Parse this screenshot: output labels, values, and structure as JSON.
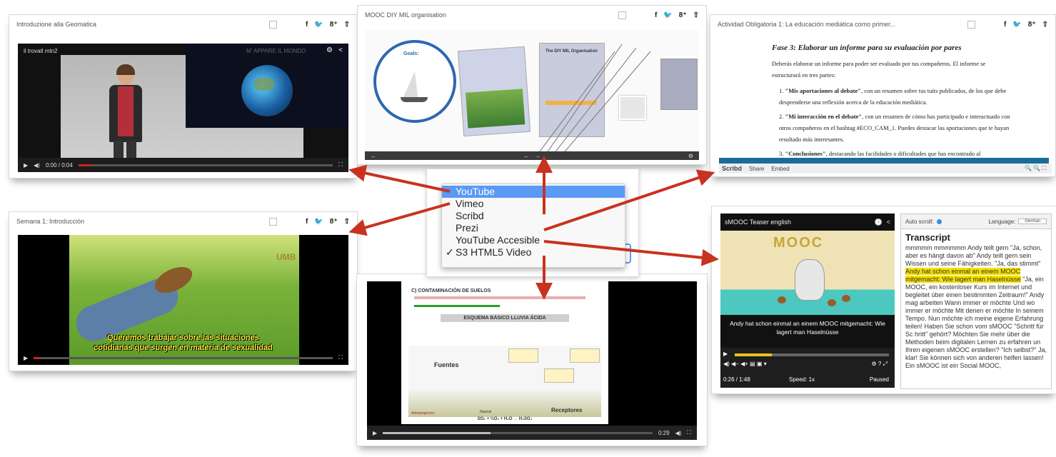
{
  "cards": {
    "geomatica": {
      "title": "Introduzione alla Geomatica",
      "video_channel": "il trovatl mtn2",
      "video_caption": "M' APPARE IL MONDO",
      "time": "0:00 / 0:04"
    },
    "prezi": {
      "title": "MOOC DIY MIL organisation",
      "bubble_title": "Goals:",
      "note_title": "The DIY MIL Organisation"
    },
    "scribd": {
      "title": "Actividad Obligatoria 1: La educación mediática como primer...",
      "heading": "Fase 3: Elaborar un informe para su evaluación por pares",
      "intro": "Deberás elaborar un informe para poder ser evaluado por tus compañeros. El informe se estructurará en tres partes:",
      "items": [
        {
          "num": "1.",
          "bold": "\"Mis aportaciones al debate\"",
          "text": ", con un resumen sobre tus tuits publicados, de los que debe desprenderse una reflexión acerca de la educación mediática."
        },
        {
          "num": "2.",
          "bold": "\"Mi interacción en el debate\"",
          "text": ", con un resumen de cómo has participado e interactuado con otros compañeros en el hashtag #ECO_CAM_1. Puedes destacar las aportaciones que te hayan resultado más interesantes."
        },
        {
          "num": "3.",
          "bold": "\"Conclusiones\"",
          "text": ", destacando las facilidades o dificultades que has encontrado al"
        }
      ],
      "footer_brand": "Scribd",
      "footer_share": "Share",
      "footer_embed": "Embed"
    },
    "semana": {
      "title": "Semana 1: Introducción",
      "logo": "UMB",
      "subtitle1": "Queremos trabajar sobre las situaciones",
      "subtitle2": "cotidianas que surgen en materia de sexualidad"
    },
    "slides": {
      "slide_title": "C) CONTAMINACIÓN DE SUELOS",
      "box_title": "ESQUEMA BÁSICO LLUVIA ÁCIDA",
      "label_fuentes": "Fuentes",
      "label_receptores": "Receptores",
      "label_natural": "Natural",
      "label_antropogenico": "Antropogénico",
      "equation": "SO₂ + ½O₂ + H₂O → H₂SO₄",
      "time": "0:29"
    },
    "smooc": {
      "title": "sMOOC Teaser english",
      "logo_text": "MOOC",
      "subtitle": "Andy hat schon einmal an einem MOOC mitgemacht: Wie lagert man Haselnüsse",
      "time": "0:26 / 1:48",
      "speed": "Speed: 1x",
      "status": "Paused",
      "auto_scroll": "Auto scroll:",
      "language_label": "Language:",
      "language_value": "German",
      "transcript_heading": "Transcript",
      "transcript_pre": "mmmmm mmmmmm Andy teilt gern \"Ja, schon, aber es hängt davon ab\" Andy teilt gern sein Wissen und seine Fähigkeiten. \"Ja, das stimmt\" ",
      "transcript_highlight": "Andy hat schon einmal an einem MOOC mitgemacht: Wie lagert man Haselnüsse",
      "transcript_post": " \"Ja, ein MOOC, ein kostenloser Kurs im Internet und begleitet über einen bestimmten Zeitraum!\" Andy mag arbeiten Wann immer er möchte Und wo immer er möchte Mit denen er möchte In seinem Tempo. Nun möchte ich meine eigene Erfahrung teilen! Haben Sie schon vom sMOOC \"Schritt für Sc hritt\" gehört? Möchten Sie mehr über die Methoden beim digitalen Lernen zu erfahren un Ihren eigenen sMOOC erstellen? \"Ich selbst?\" Ja, klar! Sie können sich von anderen helfen lassen! Ein sMOOC ist ein Social MOOC,"
    }
  },
  "dropdown": {
    "options": [
      {
        "label": "YouTube",
        "selected": true,
        "checked": false
      },
      {
        "label": "Vimeo",
        "selected": false,
        "checked": false
      },
      {
        "label": "Scribd",
        "selected": false,
        "checked": false
      },
      {
        "label": "Prezi",
        "selected": false,
        "checked": false
      },
      {
        "label": "YouTube Accesible",
        "selected": false,
        "checked": false
      },
      {
        "label": "S3 HTML5 Video",
        "selected": false,
        "checked": true
      }
    ],
    "check_mark": "✓"
  },
  "social": {
    "facebook": "f",
    "twitter": "🐦",
    "google": "8⁺",
    "share": "⇧"
  },
  "colors": {
    "arrow": "#c8321f",
    "selected": "#5b9af4",
    "highlight": "#f5e000",
    "video_bg": "#111111"
  }
}
